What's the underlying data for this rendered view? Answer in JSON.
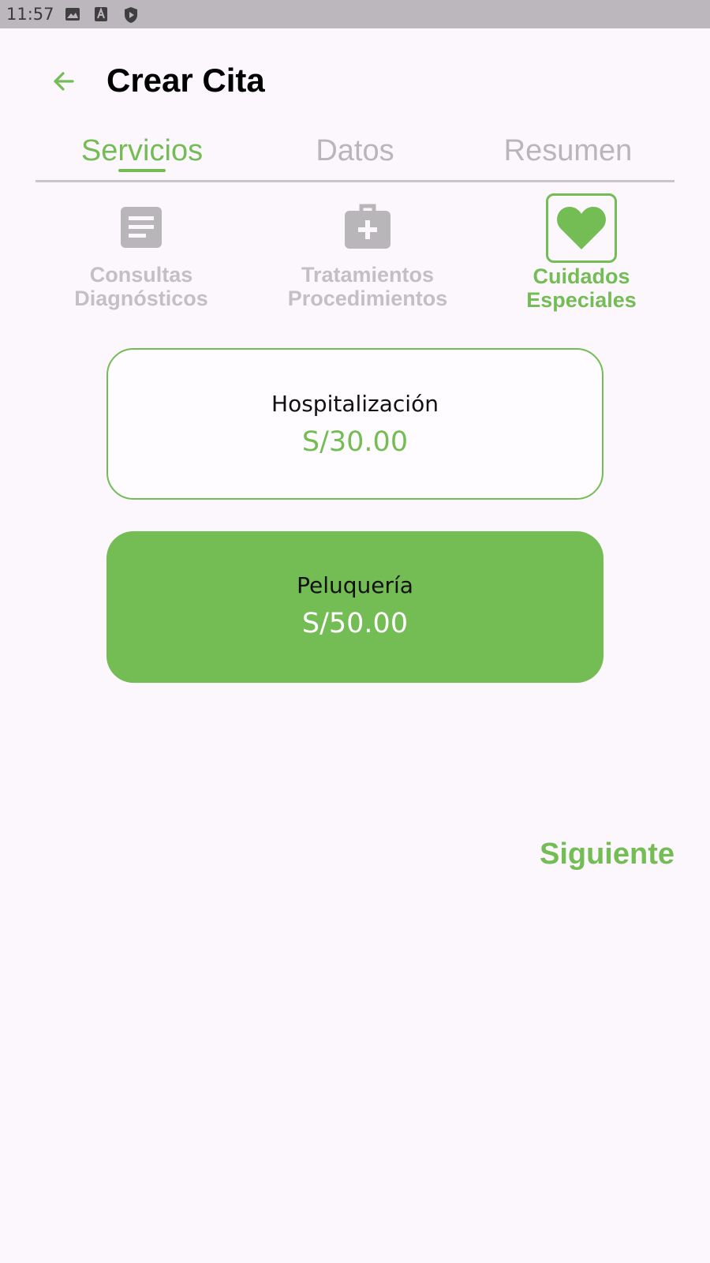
{
  "status_bar": {
    "time": "11:57",
    "icons": [
      "image-icon",
      "a-icon",
      "shield-play-icon"
    ]
  },
  "header": {
    "title": "Crear Cita",
    "back_icon": "arrow-left-icon"
  },
  "tabs": [
    {
      "label": "Servicios",
      "active": true
    },
    {
      "label": "Datos",
      "active": false
    },
    {
      "label": "Resumen",
      "active": false
    }
  ],
  "categories": [
    {
      "label_line1": "Consultas",
      "label_line2": "Diagnósticos",
      "icon": "document-icon",
      "active": false
    },
    {
      "label_line1": "Tratamientos",
      "label_line2": "Procedimientos",
      "icon": "medical-kit-icon",
      "active": false
    },
    {
      "label_line1": "Cuidados",
      "label_line2": "Especiales",
      "icon": "heart-icon",
      "active": true
    }
  ],
  "services": [
    {
      "name": "Hospitalización",
      "price": "S/30.00",
      "selected": false
    },
    {
      "name": "Peluquería",
      "price": "S/50.00",
      "selected": true
    }
  ],
  "footer": {
    "next_label": "Siguiente"
  },
  "colors": {
    "accent": "#74bc54",
    "background": "#fcf6fd",
    "inactive": "#b9b6ba"
  }
}
